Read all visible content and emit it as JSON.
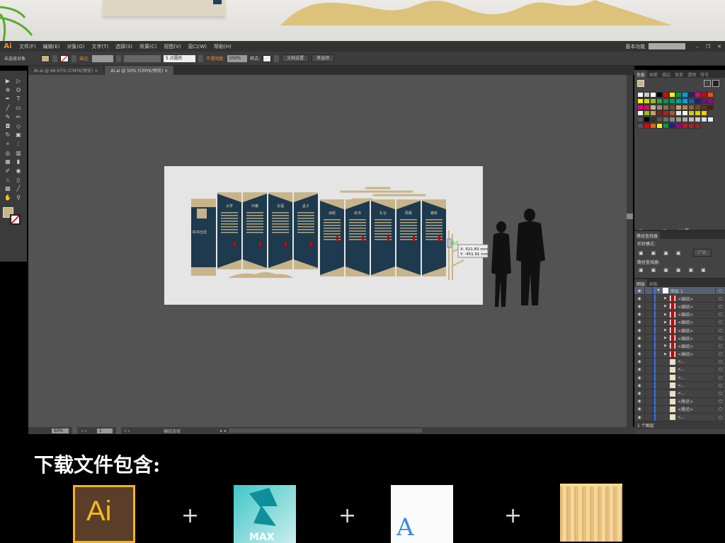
{
  "app": {
    "logo": "Ai",
    "workspace": "基本功能",
    "colors": {
      "accent": "#e8903a",
      "ui_dark": "#323232",
      "canvas": "#535353",
      "panel_navy": "#1d3a4e",
      "panel_gold": "#c8b489"
    }
  },
  "menu": [
    "文件(F)",
    "编辑(E)",
    "对象(O)",
    "文字(T)",
    "选择(S)",
    "效果(C)",
    "视图(V)",
    "窗口(W)",
    "帮助(H)"
  ],
  "control": {
    "selection": "未选择对象",
    "stroke_label": "描边:",
    "brush": "5 点圆形",
    "opacity_label": "不透明度:",
    "opacity": "100%",
    "style_label": "样式:",
    "doc_setup": "文档设置",
    "preferences": "首选项"
  },
  "tabs": [
    {
      "label": "AI.ai @ 66.67% (CMYK/预览)",
      "active": false
    },
    {
      "label": "AI.ai @ 50% (CMYK/预览)",
      "active": true
    }
  ],
  "artboard": {
    "intro_title": "四书五经",
    "panel_titles": [
      "大学",
      "中庸",
      "论语",
      "孟子",
      "诗经",
      "尚书",
      "礼记",
      "周易",
      "春秋"
    ],
    "anchor_label": "锚点",
    "coord_x": "X: 521.83 mm",
    "coord_y": "Y: -451.91 mm"
  },
  "status": {
    "zoom": "50%",
    "artboard": "1",
    "tool": "编组选择"
  },
  "swatches_panel": {
    "tabs": [
      "色板",
      "画笔",
      "描边",
      "渐变",
      "透明",
      "符号"
    ],
    "colors": [
      [
        "#ffffff",
        "#c8c8c8",
        "#ffffff",
        "#000000",
        "#e60012",
        "#fff100",
        "#009944",
        "#00a0e9",
        "#1d2088",
        "#e4007f",
        "#d7000f",
        "#e95513",
        "#f39800",
        "#f8b62d"
      ],
      [
        "#fff100",
        "#cfdb00",
        "#8fc31f",
        "#22ac38",
        "#009944",
        "#009b6b",
        "#00a29a",
        "#00a0e9",
        "#0068b7",
        "#1d2088",
        "#601986",
        "#920783",
        "#e4007f",
        "#e5006a"
      ],
      [
        "#e4007f",
        "#e5006a",
        "#c8b489",
        "#a58a6e",
        "#8c6d4f",
        "#6b4c31",
        "#c69c6d",
        "#b7844e",
        "#99602b",
        "#7d4a1c",
        "#5f3511",
        "#442409",
        "#e0e0e0",
        "#f0b000"
      ],
      [
        "#ffffff",
        "#8fc31f",
        "#c8a064",
        "#8c1c1c",
        "#b01e1e",
        "#9c5a3c",
        "#e6e6e6",
        "#ffffff",
        "#c8c820",
        "#e6c800",
        "#f0d000"
      ],
      [
        "#555555",
        "#000000",
        "#333333",
        "#555555",
        "#6e6e6e",
        "#888888",
        "#9a9a9a",
        "#aaaaaa",
        "#bbbbbb",
        "#cccccc",
        "#dddddd",
        "#eeeeee",
        "#f5e6d2",
        "#e6c8a0"
      ],
      [
        "#555555",
        "#e60012",
        "#eb6100",
        "#fff100",
        "#009944",
        "#1d2088",
        "#920783",
        "#c8161d",
        "#b81c22",
        "#a51d24"
      ]
    ]
  },
  "pathfinder": {
    "title": "路径查找器",
    "shape_modes": "形状模式:",
    "expand": "扩展",
    "pathfinders": "路径查找器:"
  },
  "layers": {
    "tabs": [
      "图层",
      "画板"
    ],
    "footer": "1 个图层",
    "rows": [
      {
        "name": "图层 1",
        "level": 0
      },
      {
        "name": "<编组>",
        "level": 1
      },
      {
        "name": "<编组>",
        "level": 1
      },
      {
        "name": "<编组>",
        "level": 1
      },
      {
        "name": "<编组>",
        "level": 1
      },
      {
        "name": "<编组>",
        "level": 1
      },
      {
        "name": "<编组>",
        "level": 1
      },
      {
        "name": "<编组>",
        "level": 1
      },
      {
        "name": "<编组>",
        "level": 1
      },
      {
        "name": "<...",
        "level": 2
      },
      {
        "name": "<...",
        "level": 2
      },
      {
        "name": "<...",
        "level": 2
      },
      {
        "name": "<...",
        "level": 2
      },
      {
        "name": "<...",
        "level": 2
      },
      {
        "name": "<路径>",
        "level": 2
      },
      {
        "name": "<路径>",
        "level": 2
      },
      {
        "name": "<...",
        "level": 2
      }
    ]
  },
  "promo": {
    "title": "下载文件包含:",
    "plus": "+",
    "files": [
      {
        "icon": "ai-file-icon",
        "label": "Ai"
      },
      {
        "icon": "3dsmax-file-icon",
        "label": "MAX"
      },
      {
        "icon": "font-file-icon",
        "label": "A"
      },
      {
        "icon": "wood-texture-icon",
        "label": ""
      }
    ]
  }
}
